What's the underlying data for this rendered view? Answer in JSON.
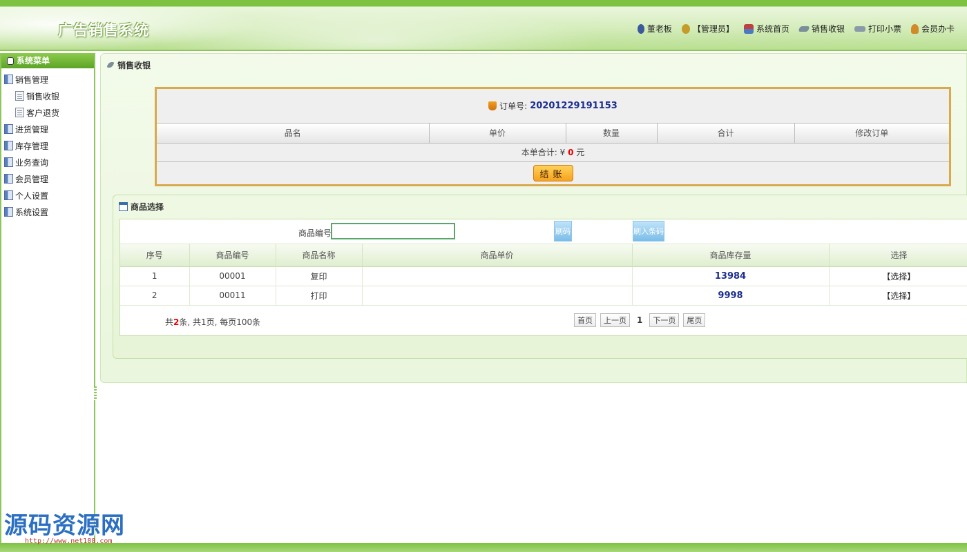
{
  "header": {
    "title": "广告销售系统",
    "nav": [
      {
        "icon": "user-icon",
        "label": "董老板",
        "color": "#3b5a9a"
      },
      {
        "icon": "admin-icon",
        "label": "【管理员】",
        "color": "#c59b2a"
      },
      {
        "icon": "home-icon",
        "label": "系统首页",
        "color": "#c04040"
      },
      {
        "icon": "cashier-icon",
        "label": "销售收银",
        "color": "#7a8f9a"
      },
      {
        "icon": "print-icon",
        "label": "打印小票",
        "color": "#8a9aa8"
      },
      {
        "icon": "member-icon",
        "label": "会员办卡",
        "color": "#d08a2a"
      }
    ]
  },
  "sidebar": {
    "title": "系统菜单",
    "items": [
      {
        "label": "销售管理",
        "sub": false
      },
      {
        "label": "销售收银",
        "sub": true
      },
      {
        "label": "客户退货",
        "sub": true
      },
      {
        "label": "进货管理",
        "sub": false
      },
      {
        "label": "库存管理",
        "sub": false
      },
      {
        "label": "业务查询",
        "sub": false
      },
      {
        "label": "会员管理",
        "sub": false
      },
      {
        "label": "个人设置",
        "sub": false
      },
      {
        "label": "系统设置",
        "sub": false
      }
    ]
  },
  "content": {
    "title": "销售收银"
  },
  "order": {
    "order_no_label": "订单号:",
    "order_no": "20201229191153",
    "columns": [
      "品名",
      "单价",
      "数量",
      "合计",
      "修改订单"
    ],
    "total_label": "本单合计: ¥",
    "total_value": "0",
    "total_unit": "元",
    "checkout_label": "结账"
  },
  "products": {
    "title": "商品选择",
    "search_label": "商品编号:",
    "search_value": "",
    "scan_button": "刷码",
    "barcode_button": "刷入条码",
    "columns": [
      "序号",
      "商品编号",
      "商品名称",
      "商品单价",
      "商品库存量",
      "选择"
    ],
    "rows": [
      {
        "index": "1",
        "code": "00001",
        "name": "复印",
        "price": "",
        "stock": "13984",
        "action": "【选择】"
      },
      {
        "index": "2",
        "code": "00011",
        "name": "打印",
        "price": "",
        "stock": "9998",
        "action": "【选择】"
      }
    ],
    "pager": {
      "prefix": "共",
      "count": "2",
      "suffix": "条, 共1页, 每页100条",
      "first": "首页",
      "prev": "上一页",
      "current": "1",
      "next": "下一页",
      "last": "尾页"
    }
  },
  "watermark": {
    "text": "源码资源网",
    "url": "http://www.net188.com"
  }
}
